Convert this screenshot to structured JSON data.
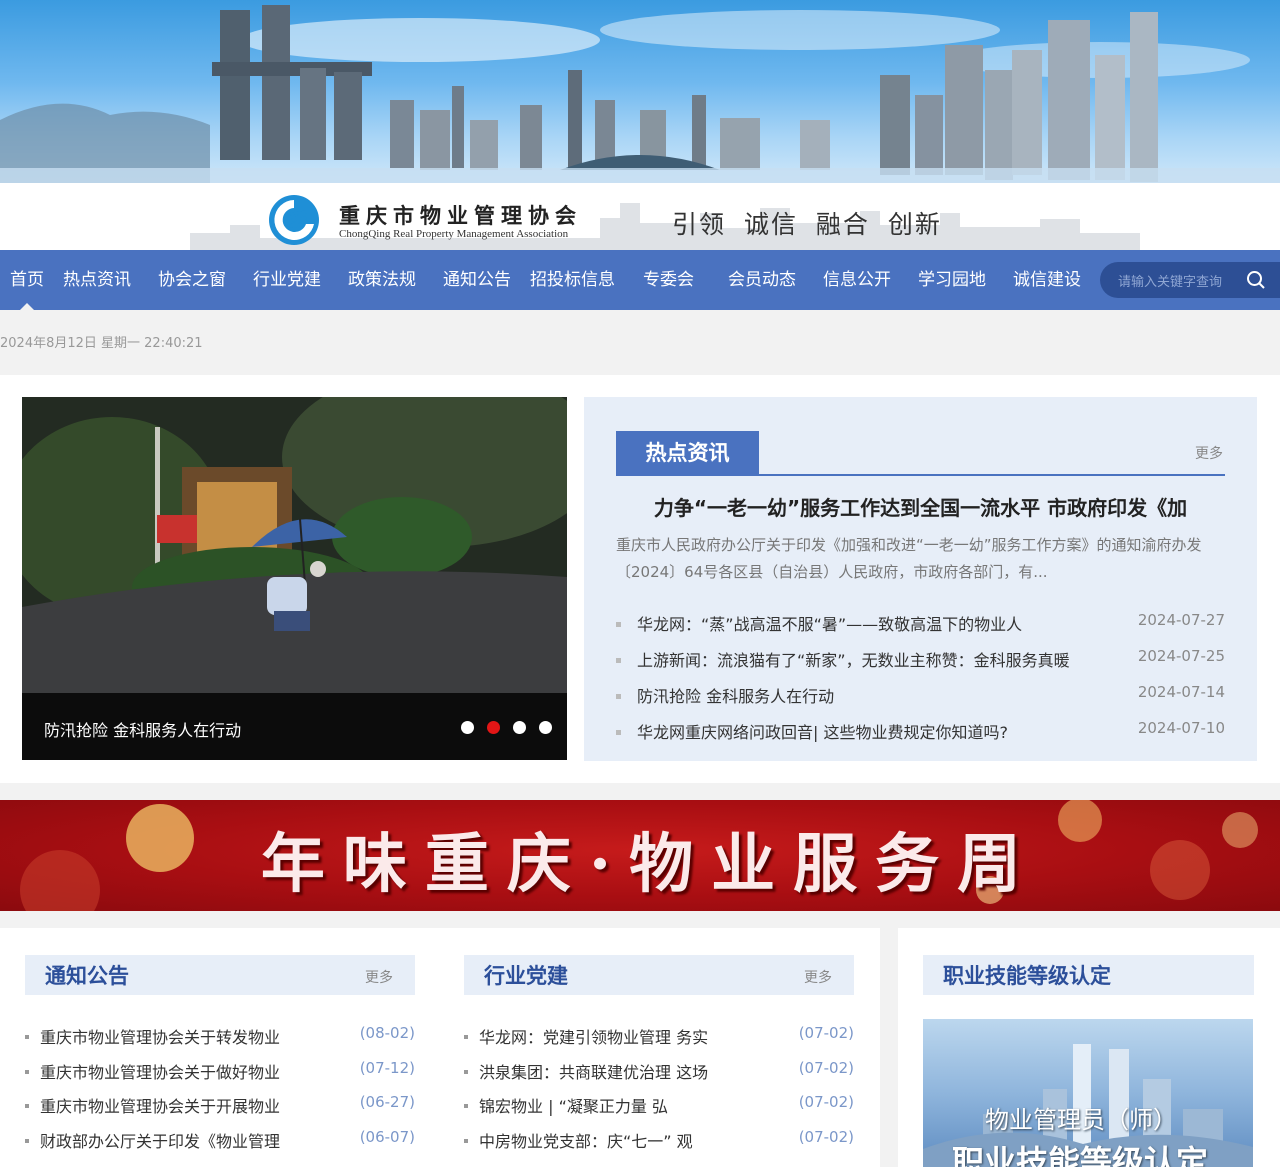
{
  "org": {
    "name_cn": "重庆市物业管理协会",
    "name_en": "ChongQing Real Property Management Association",
    "slogan": "引领 诚信 融合 创新"
  },
  "nav": {
    "items": [
      "首页",
      "热点资讯",
      "协会之窗",
      "行业党建",
      "政策法规",
      "通知公告",
      "招投标信息",
      "专委会",
      "会员动态",
      "信息公开",
      "学习园地",
      "诚信建设"
    ],
    "active": "首页",
    "search_placeholder": "请输入关键字查询"
  },
  "datetime": "2024年8月12日 星期一 22:40:21",
  "slider": {
    "caption": "防汛抢险 金科服务人在行动",
    "total_slides": 4,
    "active_slide": 2
  },
  "hot_news": {
    "tab": "热点资讯",
    "more": "更多",
    "headline": "力争“一老一幼”服务工作达到全国一流水平 市政府印发《加",
    "summary": "重庆市人民政府办公厅关于印发《加强和改进“一老一幼”服务工作方案》的通知渝府办发〔2024〕64号各区县（自治县）人民政府，市政府各部门，有...",
    "items": [
      {
        "title": "华龙网：“蒸”战高温不服“暑”——致敬高温下的物业人",
        "date": "2024-07-27"
      },
      {
        "title": "上游新闻：流浪猫有了“新家”，无数业主称赞：金科服务真暖",
        "date": "2024-07-25"
      },
      {
        "title": "防汛抢险 金科服务人在行动",
        "date": "2024-07-14"
      },
      {
        "title": "华龙网重庆网络问政回音| 这些物业费规定你知道吗?",
        "date": "2024-07-10"
      }
    ]
  },
  "red_banner": {
    "title": "年味重庆·物业服务周"
  },
  "notices": {
    "title": "通知公告",
    "more": "更多",
    "items": [
      {
        "title": "重庆市物业管理协会关于转发物业",
        "date": "(08-02)"
      },
      {
        "title": "重庆市物业管理协会关于做好物业",
        "date": "(07-12)"
      },
      {
        "title": "重庆市物业管理协会关于开展物业",
        "date": "(06-27)"
      },
      {
        "title": "财政部办公厅关于印发《物业管理",
        "date": "(06-07)"
      }
    ]
  },
  "party": {
    "title": "行业党建",
    "more": "更多",
    "items": [
      {
        "title": "华龙网：党建引领物业管理 务实",
        "date": "(07-02)"
      },
      {
        "title": "洪泉集团：共商联建优治理 这场",
        "date": "(07-02)"
      },
      {
        "title": "锦宏物业 | “凝聚正力量 弘",
        "date": "(07-02)"
      },
      {
        "title": "中房物业党支部：庆“七一” 观",
        "date": "(07-02)"
      }
    ]
  },
  "cert": {
    "title": "职业技能等级认定",
    "image_line1": "物业管理员（师）",
    "image_line2": "职业技能等级认定"
  }
}
